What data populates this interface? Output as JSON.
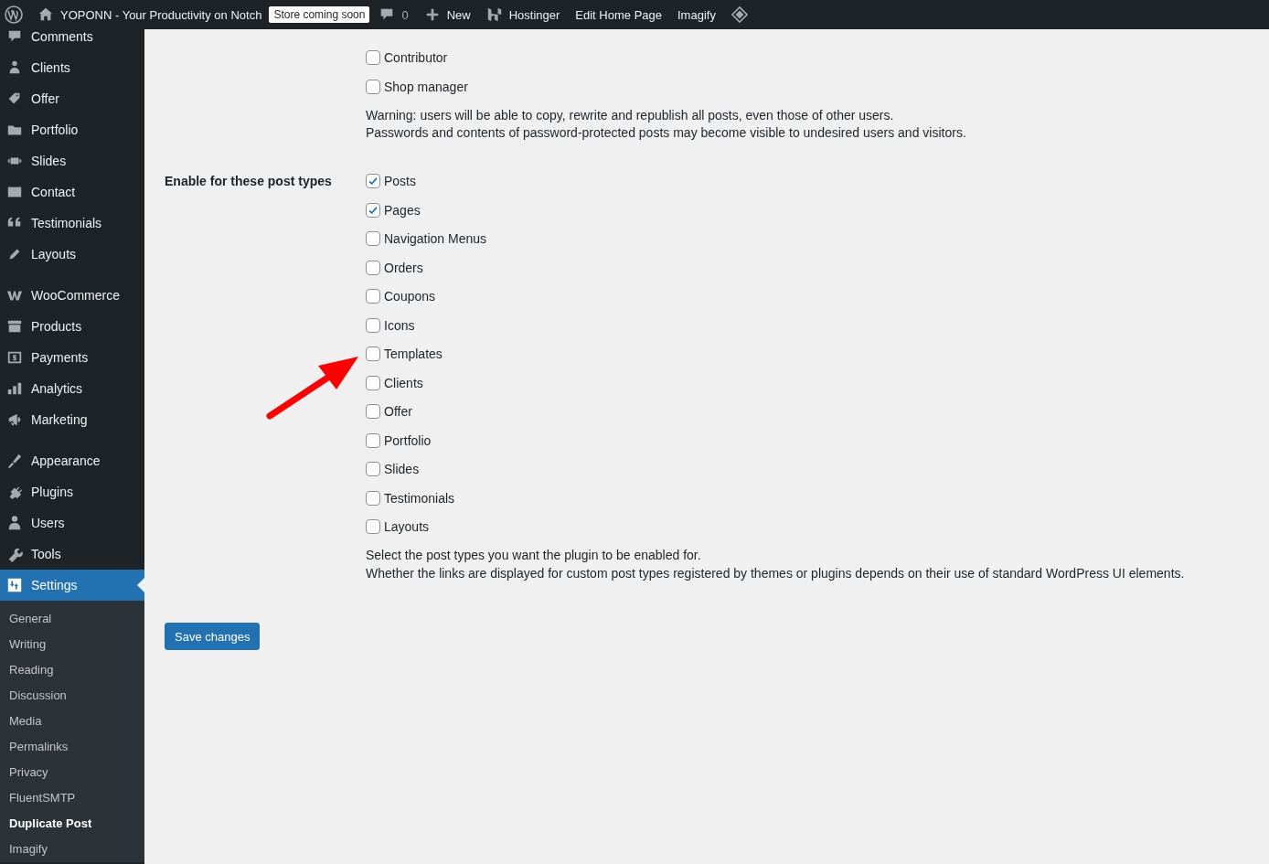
{
  "admin_bar": {
    "site_name": "YOPONN - Your Productivity on Notch",
    "badge": "Store coming soon",
    "comments_count": "0",
    "new_label": "New",
    "items": [
      "Hostinger",
      "Edit Home Page",
      "Imagify"
    ]
  },
  "sidebar": {
    "groups": [
      [
        {
          "label": "Comments",
          "selected": false
        },
        {
          "label": "Clients",
          "selected": false
        },
        {
          "label": "Offer",
          "selected": false
        },
        {
          "label": "Portfolio",
          "selected": false
        },
        {
          "label": "Slides",
          "selected": false
        },
        {
          "label": "Contact",
          "selected": false
        },
        {
          "label": "Testimonials",
          "selected": false
        },
        {
          "label": "Layouts",
          "selected": false
        }
      ],
      [
        {
          "label": "WooCommerce",
          "selected": false
        },
        {
          "label": "Products",
          "selected": false
        },
        {
          "label": "Payments",
          "selected": false
        },
        {
          "label": "Analytics",
          "selected": false
        },
        {
          "label": "Marketing",
          "selected": false
        }
      ],
      [
        {
          "label": "Appearance",
          "selected": false
        },
        {
          "label": "Plugins",
          "selected": false
        },
        {
          "label": "Users",
          "selected": false
        },
        {
          "label": "Tools",
          "selected": false
        },
        {
          "label": "Settings",
          "selected": true
        }
      ]
    ],
    "submenu": [
      {
        "label": "General",
        "selected": false
      },
      {
        "label": "Writing",
        "selected": false
      },
      {
        "label": "Reading",
        "selected": false
      },
      {
        "label": "Discussion",
        "selected": false
      },
      {
        "label": "Media",
        "selected": false
      },
      {
        "label": "Permalinks",
        "selected": false
      },
      {
        "label": "Privacy",
        "selected": false
      },
      {
        "label": "FluentSMTP",
        "selected": false
      },
      {
        "label": "Duplicate Post",
        "selected": true
      },
      {
        "label": "Imagify",
        "selected": false
      }
    ]
  },
  "roles_field": {
    "options": [
      {
        "label": "Contributor",
        "checked": false
      },
      {
        "label": "Shop manager",
        "checked": false
      }
    ],
    "notes": [
      "Warning: users will be able to copy, rewrite and republish all posts, even those of other users.",
      "Passwords and contents of password-protected posts may become visible to undesired users and visitors."
    ]
  },
  "post_types_field": {
    "label": "Enable for these post types",
    "options": [
      {
        "label": "Posts",
        "checked": true
      },
      {
        "label": "Pages",
        "checked": true
      },
      {
        "label": "Navigation Menus",
        "checked": false
      },
      {
        "label": "Orders",
        "checked": false
      },
      {
        "label": "Coupons",
        "checked": false
      },
      {
        "label": "Icons",
        "checked": false
      },
      {
        "label": "Templates",
        "checked": false
      },
      {
        "label": "Clients",
        "checked": false
      },
      {
        "label": "Offer",
        "checked": false
      },
      {
        "label": "Portfolio",
        "checked": false
      },
      {
        "label": "Slides",
        "checked": false
      },
      {
        "label": "Testimonials",
        "checked": false
      },
      {
        "label": "Layouts",
        "checked": false
      }
    ],
    "notes": [
      "Select the post types you want the plugin to be enabled for.",
      "Whether the links are displayed for custom post types registered by themes or plugins depends on their use of standard WordPress UI elements."
    ]
  },
  "save_button": "Save changes"
}
